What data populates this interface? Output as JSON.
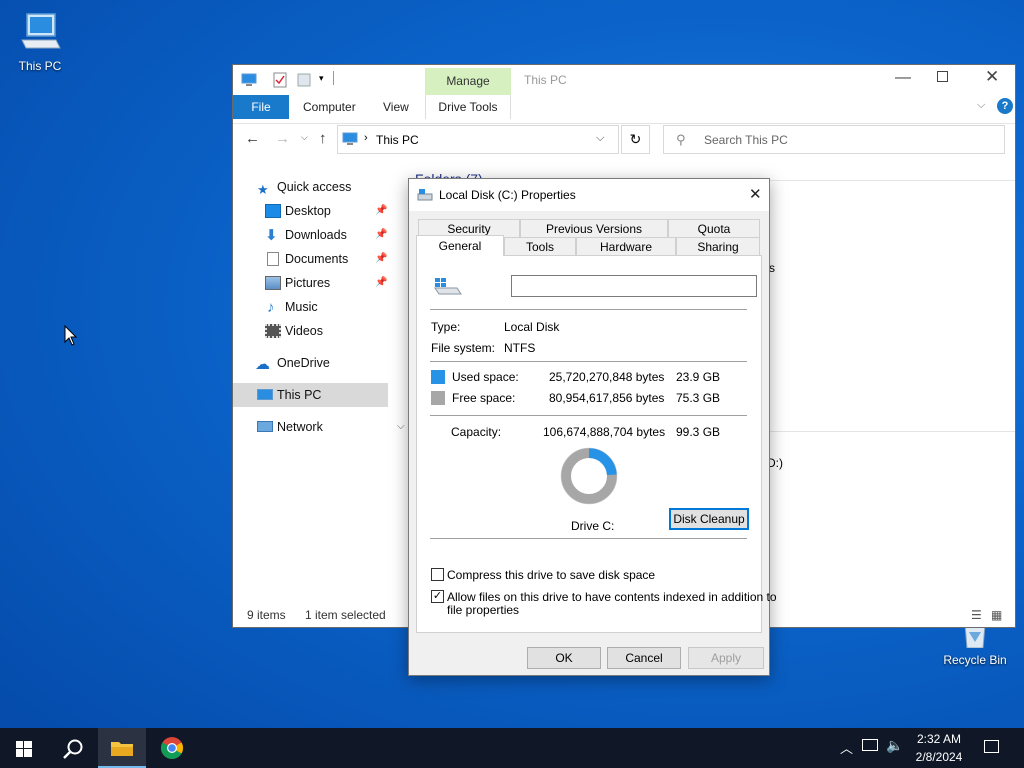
{
  "desktop": {
    "this_pc_label": "This PC",
    "recycle_bin_label": "Recycle Bin"
  },
  "explorer": {
    "title": "This PC",
    "manage_tab": "Manage",
    "drive_tools_tab": "Drive Tools",
    "ribbon_tabs": [
      "File",
      "Computer",
      "View"
    ],
    "address_path": "This PC",
    "search_placeholder": "Search This PC",
    "folders_header": "Folders (7)",
    "nav": {
      "quick_access": "Quick access",
      "desktop": "Desktop",
      "downloads": "Downloads",
      "documents": "Documents",
      "pictures": "Pictures",
      "music": "Music",
      "videos": "Videos",
      "onedrive": "OneDrive",
      "this_pc": "This PC",
      "network": "Network"
    },
    "status_items": "9 items",
    "status_selected": "1 item selected",
    "partial_s": "s",
    "partial_d": "D:)"
  },
  "dialog": {
    "title": "Local Disk (C:) Properties",
    "tabs_row1": [
      "Security",
      "Previous Versions",
      "Quota"
    ],
    "tabs_row2": [
      "General",
      "Tools",
      "Hardware",
      "Sharing"
    ],
    "name_value": "",
    "type_label": "Type:",
    "type_value": "Local Disk",
    "fs_label": "File system:",
    "fs_value": "NTFS",
    "used_label": "Used space:",
    "used_bytes": "25,720,270,848 bytes",
    "used_gb": "23.9 GB",
    "free_label": "Free space:",
    "free_bytes": "80,954,617,856 bytes",
    "free_gb": "75.3 GB",
    "capacity_label": "Capacity:",
    "capacity_bytes": "106,674,888,704 bytes",
    "capacity_gb": "99.3 GB",
    "drive_label": "Drive C:",
    "used_fraction": 0.241,
    "disk_cleanup": "Disk Cleanup",
    "compress_label": "Compress this drive to save disk space",
    "compress_checked": false,
    "index_label_1": "Allow files on this drive to have contents indexed in addition to",
    "index_label_2": "file properties",
    "index_checked": true,
    "ok": "OK",
    "cancel": "Cancel",
    "apply": "Apply",
    "colors": {
      "used": "#2693e6",
      "free": "#a7a7a7"
    }
  },
  "taskbar": {
    "time": "2:32 AM",
    "date": "2/8/2024"
  }
}
